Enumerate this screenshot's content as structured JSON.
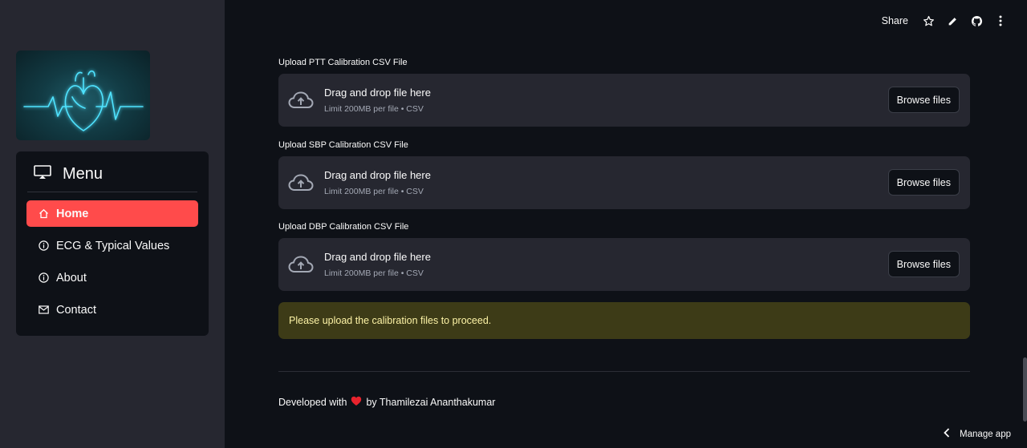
{
  "sidebar": {
    "menu_title": "Menu",
    "items": [
      {
        "label": "Home",
        "icon": "home-icon",
        "active": true
      },
      {
        "label": "ECG & Typical Values",
        "icon": "info-icon",
        "active": false
      },
      {
        "label": "About",
        "icon": "info-icon",
        "active": false
      },
      {
        "label": "Contact",
        "icon": "envelope-icon",
        "active": false
      }
    ]
  },
  "toolbar": {
    "share_label": "Share",
    "icons": [
      "star-icon",
      "pencil-icon",
      "github-icon",
      "more-vertical-icon"
    ]
  },
  "uploads": [
    {
      "label": "Upload PTT Calibration CSV File",
      "drop_text": "Drag and drop file here",
      "limit_text": "Limit 200MB per file • CSV",
      "button": "Browse files"
    },
    {
      "label": "Upload SBP Calibration CSV File",
      "drop_text": "Drag and drop file here",
      "limit_text": "Limit 200MB per file • CSV",
      "button": "Browse files"
    },
    {
      "label": "Upload DBP Calibration CSV File",
      "drop_text": "Drag and drop file here",
      "limit_text": "Limit 200MB per file • CSV",
      "button": "Browse files"
    }
  ],
  "alert": {
    "text": "Please upload the calibration files to proceed."
  },
  "footer": {
    "prefix": "Developed with",
    "suffix": "by Thamilezai Ananthakumar"
  },
  "manage_app": {
    "label": "Manage app"
  },
  "colors": {
    "accent": "#ff4b4b",
    "background": "#0e1117",
    "sidebar": "#262730",
    "warning_bg": "#3d3b17",
    "warning_text": "#fdf3a6"
  }
}
